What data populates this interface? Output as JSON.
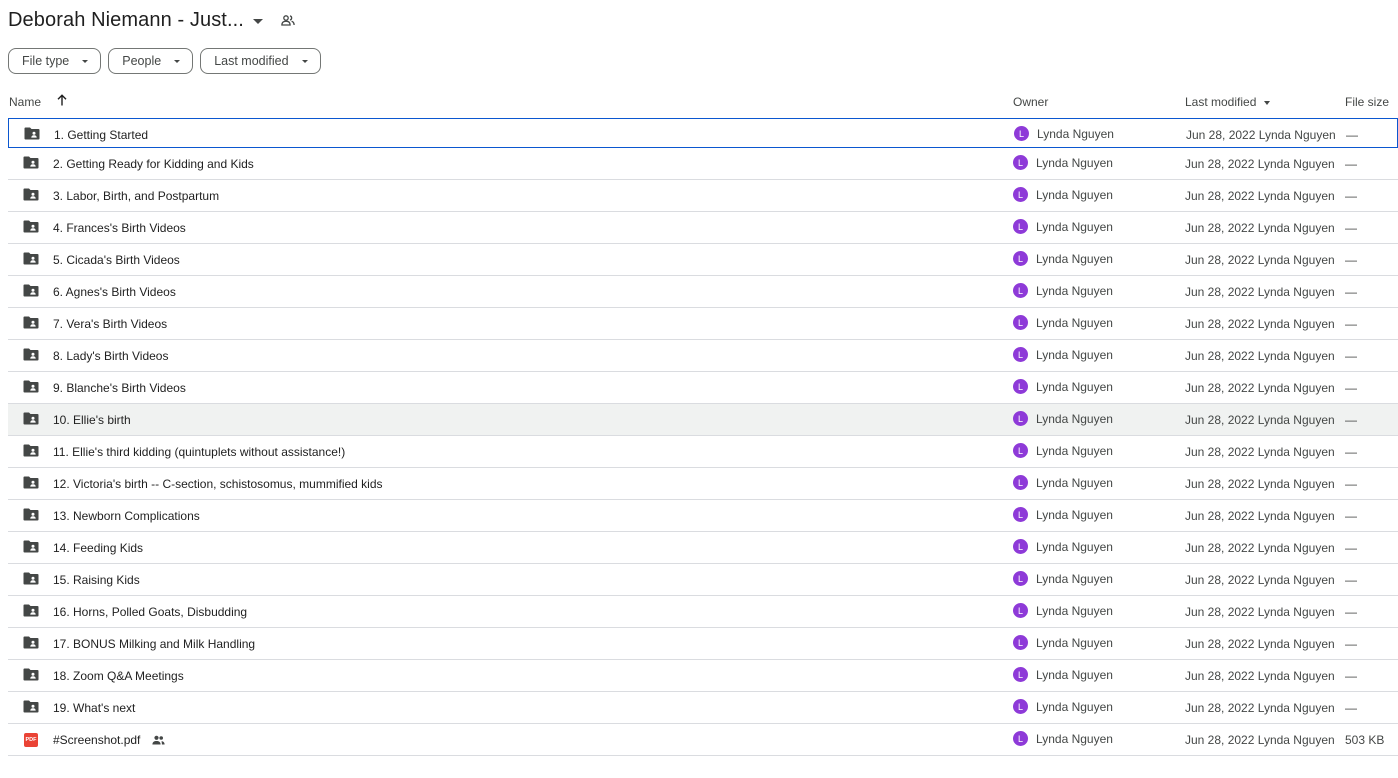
{
  "header": {
    "title": "Deborah Niemann - Just..."
  },
  "filters": [
    {
      "label": "File type"
    },
    {
      "label": "People"
    },
    {
      "label": "Last modified"
    }
  ],
  "columns": {
    "name": "Name",
    "owner": "Owner",
    "last_modified": "Last modified",
    "file_size": "File size"
  },
  "rows": [
    {
      "name": "1. Getting Started",
      "type": "folder",
      "owner_initial": "L",
      "owner": "Lynda Nguyen",
      "modified": "Jun 28, 2022 Lynda Nguyen",
      "size": "—"
    },
    {
      "name": "2. Getting Ready for Kidding and Kids",
      "type": "folder",
      "owner_initial": "L",
      "owner": "Lynda Nguyen",
      "modified": "Jun 28, 2022 Lynda Nguyen",
      "size": "—"
    },
    {
      "name": "3. Labor, Birth, and Postpartum",
      "type": "folder",
      "owner_initial": "L",
      "owner": "Lynda Nguyen",
      "modified": "Jun 28, 2022 Lynda Nguyen",
      "size": "—"
    },
    {
      "name": "4. Frances's Birth Videos",
      "type": "folder",
      "owner_initial": "L",
      "owner": "Lynda Nguyen",
      "modified": "Jun 28, 2022 Lynda Nguyen",
      "size": "—"
    },
    {
      "name": "5. Cicada's Birth Videos",
      "type": "folder",
      "owner_initial": "L",
      "owner": "Lynda Nguyen",
      "modified": "Jun 28, 2022 Lynda Nguyen",
      "size": "—"
    },
    {
      "name": "6. Agnes's Birth Videos",
      "type": "folder",
      "owner_initial": "L",
      "owner": "Lynda Nguyen",
      "modified": "Jun 28, 2022 Lynda Nguyen",
      "size": "—"
    },
    {
      "name": "7. Vera's Birth Videos",
      "type": "folder",
      "owner_initial": "L",
      "owner": "Lynda Nguyen",
      "modified": "Jun 28, 2022 Lynda Nguyen",
      "size": "—"
    },
    {
      "name": "8. Lady's Birth Videos",
      "type": "folder",
      "owner_initial": "L",
      "owner": "Lynda Nguyen",
      "modified": "Jun 28, 2022 Lynda Nguyen",
      "size": "—"
    },
    {
      "name": "9. Blanche's Birth Videos",
      "type": "folder",
      "owner_initial": "L",
      "owner": "Lynda Nguyen",
      "modified": "Jun 28, 2022 Lynda Nguyen",
      "size": "—"
    },
    {
      "name": "10. Ellie's birth",
      "type": "folder",
      "owner_initial": "L",
      "owner": "Lynda Nguyen",
      "modified": "Jun 28, 2022 Lynda Nguyen",
      "size": "—"
    },
    {
      "name": "11. Ellie's third kidding (quintuplets without assistance!)",
      "type": "folder",
      "owner_initial": "L",
      "owner": "Lynda Nguyen",
      "modified": "Jun 28, 2022 Lynda Nguyen",
      "size": "—"
    },
    {
      "name": "12. Victoria's birth -- C-section, schistosomus, mummified kids",
      "type": "folder",
      "owner_initial": "L",
      "owner": "Lynda Nguyen",
      "modified": "Jun 28, 2022 Lynda Nguyen",
      "size": "—"
    },
    {
      "name": "13. Newborn Complications",
      "type": "folder",
      "owner_initial": "L",
      "owner": "Lynda Nguyen",
      "modified": "Jun 28, 2022 Lynda Nguyen",
      "size": "—"
    },
    {
      "name": "14. Feeding Kids",
      "type": "folder",
      "owner_initial": "L",
      "owner": "Lynda Nguyen",
      "modified": "Jun 28, 2022 Lynda Nguyen",
      "size": "—"
    },
    {
      "name": "15. Raising Kids",
      "type": "folder",
      "owner_initial": "L",
      "owner": "Lynda Nguyen",
      "modified": "Jun 28, 2022 Lynda Nguyen",
      "size": "—"
    },
    {
      "name": "16. Horns, Polled Goats, Disbudding",
      "type": "folder",
      "owner_initial": "L",
      "owner": "Lynda Nguyen",
      "modified": "Jun 28, 2022 Lynda Nguyen",
      "size": "—"
    },
    {
      "name": "17. BONUS Milking and Milk Handling",
      "type": "folder",
      "owner_initial": "L",
      "owner": "Lynda Nguyen",
      "modified": "Jun 28, 2022 Lynda Nguyen",
      "size": "—"
    },
    {
      "name": "18. Zoom Q&A Meetings",
      "type": "folder",
      "owner_initial": "L",
      "owner": "Lynda Nguyen",
      "modified": "Jun 28, 2022 Lynda Nguyen",
      "size": "—"
    },
    {
      "name": "19. What's next",
      "type": "folder",
      "owner_initial": "L",
      "owner": "Lynda Nguyen",
      "modified": "Jun 28, 2022 Lynda Nguyen",
      "size": "—"
    },
    {
      "name": "#Screenshot.pdf",
      "type": "pdf",
      "pdf_label": "PDF",
      "shared": true,
      "owner_initial": "L",
      "owner": "Lynda Nguyen",
      "modified": "Jun 28, 2022 Lynda Nguyen",
      "size": "503 KB"
    }
  ],
  "icons": {
    "title_dropdown": "chevron-down-icon",
    "shared": "people-icon",
    "sort": "arrow-up-icon",
    "folder": "shared-folder-icon",
    "pdf": "pdf-icon"
  },
  "colors": {
    "avatar": "#8e3ad8",
    "selection_border": "#0b57d0",
    "pdf": "#ea4335"
  }
}
